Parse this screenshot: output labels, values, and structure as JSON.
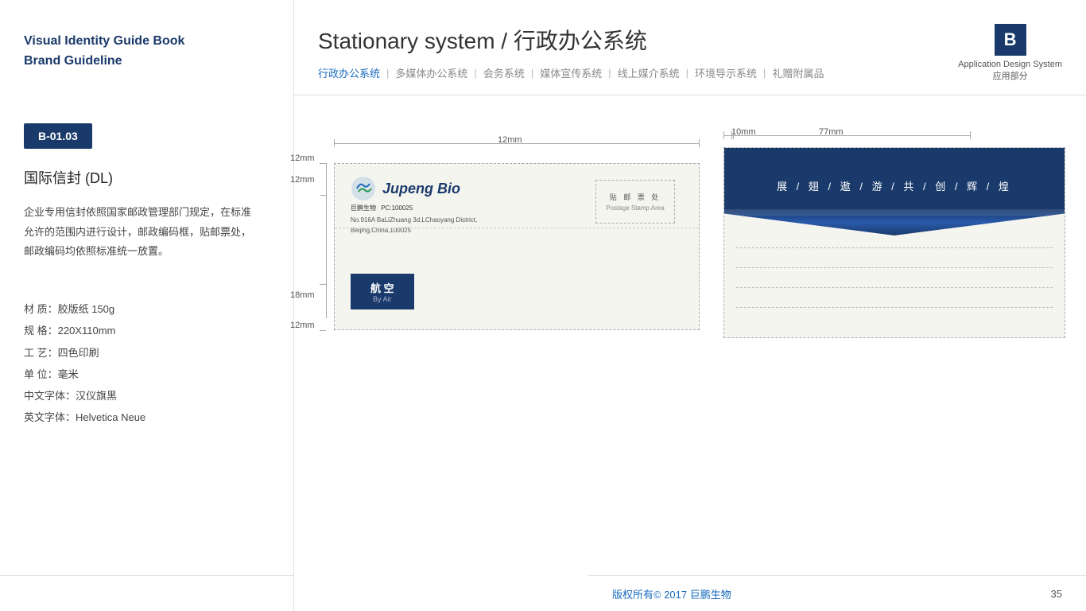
{
  "sidebar": {
    "title_line1": "Visual Identity Guide Book",
    "title_line2": "Brand Guideline",
    "badge": "B-01.03",
    "section_title": "国际信封 (DL)",
    "description": "企业专用信封依照国家邮政管理部门规定，在标准允许的范围内进行设计，邮政编码框，贴邮票处，邮政编码均依照标准统一放置。",
    "specs": [
      "材 质：胶版纸 150g",
      "规 格：220X110mm",
      "工 艺：四色印刷",
      "单 位：毫米",
      "中文字体：汉仪旗黑",
      "英文字体：Helvetica Neue"
    ]
  },
  "header": {
    "title": "Stationary system  /  行政办公系统",
    "nav": [
      {
        "label": "行政办公系统",
        "active": true
      },
      {
        "label": "多媒体办公系统",
        "active": false
      },
      {
        "label": "会务系统",
        "active": false
      },
      {
        "label": "媒体宣传系统",
        "active": false
      },
      {
        "label": "线上媒介系统",
        "active": false
      },
      {
        "label": "环境导示系统",
        "active": false
      },
      {
        "label": "礼赠附属品",
        "active": false
      }
    ],
    "brand_letter": "B",
    "brand_label_line1": "Application Design System",
    "brand_label_line2": "应用部分"
  },
  "envelope": {
    "front": {
      "company_name_cn": "巨鹏生物",
      "company_name_en": "Jupeng Bio",
      "company_address_cn": "PC:100025",
      "company_address_en1": "No.916A BaLiZhuang 3d,LChaoyang District,",
      "company_address_en2": "Beijing,China,100025",
      "postage_title": "贴 邮 票 处",
      "postage_sub": "Postage Stamp Area",
      "air_label": "航 空",
      "air_sub": "By Air",
      "measure_12mm_top": "12mm",
      "measure_12mm_top2": "12mm",
      "measure_18mm": "18mm",
      "measure_12mm_bot": "12mm"
    },
    "back": {
      "flap_text": "展 / 翅 / 遨 / 游 / 共 / 创 / 辉 / 煌",
      "measure_77mm": "77mm",
      "measure_10mm": "10mm"
    }
  },
  "footer": {
    "copyright": "版权所有©  2017  巨鹏生物",
    "page": "35"
  }
}
